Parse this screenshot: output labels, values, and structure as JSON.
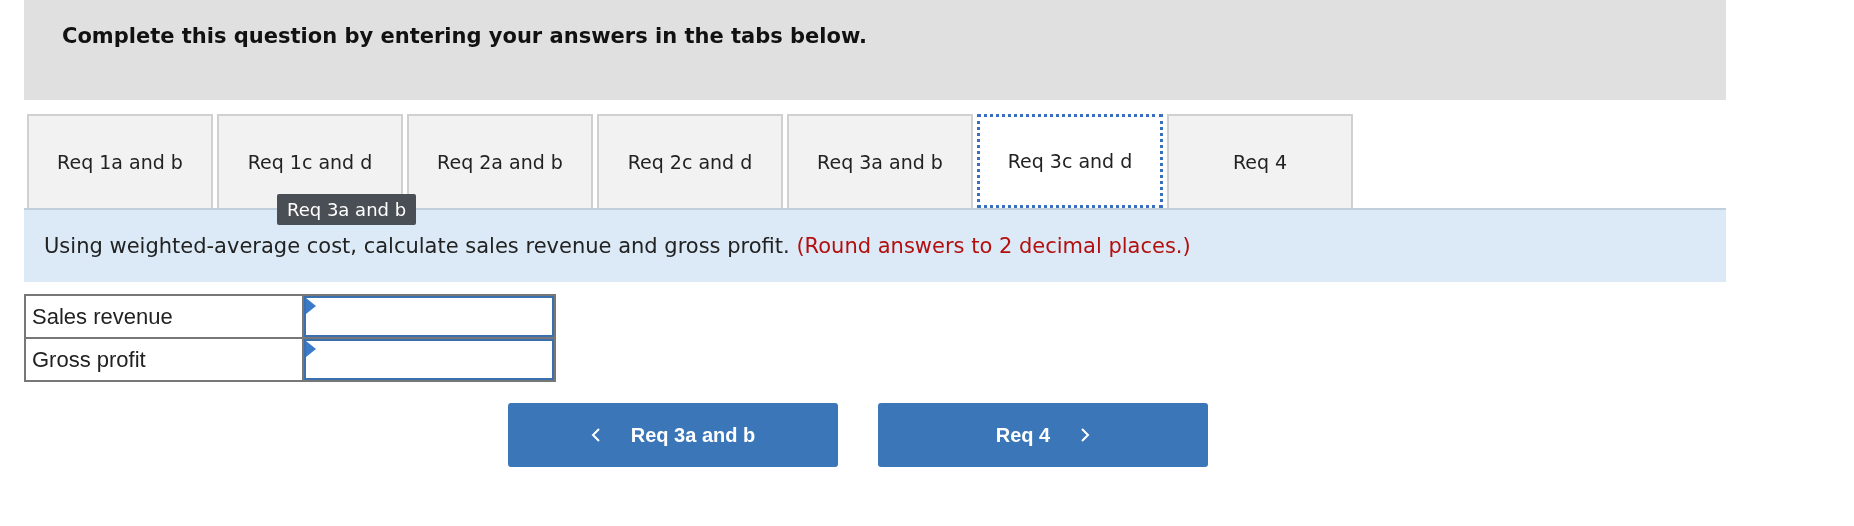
{
  "header": {
    "title": "Complete this question by entering your answers in the tabs below."
  },
  "tabs": [
    {
      "label": "Req 1a and b",
      "selected": false
    },
    {
      "label": "Req 1c and d",
      "selected": false
    },
    {
      "label": "Req 2a and b",
      "selected": false
    },
    {
      "label": "Req 2c and d",
      "selected": false
    },
    {
      "label": "Req 3a and b",
      "selected": false
    },
    {
      "label": "Req 3c and d",
      "selected": true
    },
    {
      "label": "Req 4",
      "selected": false
    }
  ],
  "tooltip": {
    "text": "Req 3a and b"
  },
  "instruction": {
    "text": "Using weighted-average cost, calculate sales revenue and gross profit.",
    "note": "(Round answers to 2 decimal places.)"
  },
  "answer_table": {
    "rows": [
      {
        "label": "Sales revenue"
      },
      {
        "label": "Gross profit"
      }
    ]
  },
  "nav_buttons": [
    {
      "kind": "prev",
      "label": "Req 3a and b"
    },
    {
      "kind": "next",
      "label": "Req 4"
    }
  ]
}
